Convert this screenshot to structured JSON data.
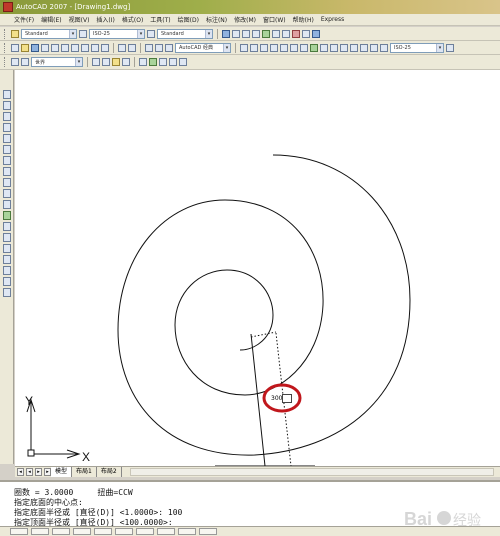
{
  "window": {
    "title": "AutoCAD 2007 - [Drawing1.dwg]"
  },
  "menu": [
    "文件(F)",
    "编辑(E)",
    "视图(V)",
    "插入(I)",
    "格式(O)",
    "工具(T)",
    "绘图(D)",
    "标注(N)",
    "修改(M)",
    "窗口(W)",
    "帮助(H)",
    "Express"
  ],
  "toolbar1": {
    "text_style": "Standard",
    "dim_style": "ISO-25",
    "table_style": "Standard"
  },
  "toolbar2": {
    "workspace": "AutoCAD 经典",
    "dim_style_2": "ISO-25"
  },
  "toolbar3": {
    "ucs": "世界"
  },
  "drawing": {
    "helix_turns": "3.0000",
    "dynamic_input_value": "300",
    "ucs_axis_x": "X",
    "ucs_axis_y": "Y"
  },
  "layout_tabs": [
    "模型",
    "布局1",
    "布局2"
  ],
  "command_lines": [
    "圈数 = 3.0000     扭曲=CCW",
    "指定底面的中心点:",
    "指定底面半径或 [直径(D)] <1.0000>: 100",
    "指定顶面半径或 [直径(D)] <100.0000>:"
  ],
  "watermark": "Baidu 经验",
  "colors": {
    "highlight_circle": "#c0171c",
    "canvas": "#ffffff",
    "title_bar": "#9fae4a"
  }
}
